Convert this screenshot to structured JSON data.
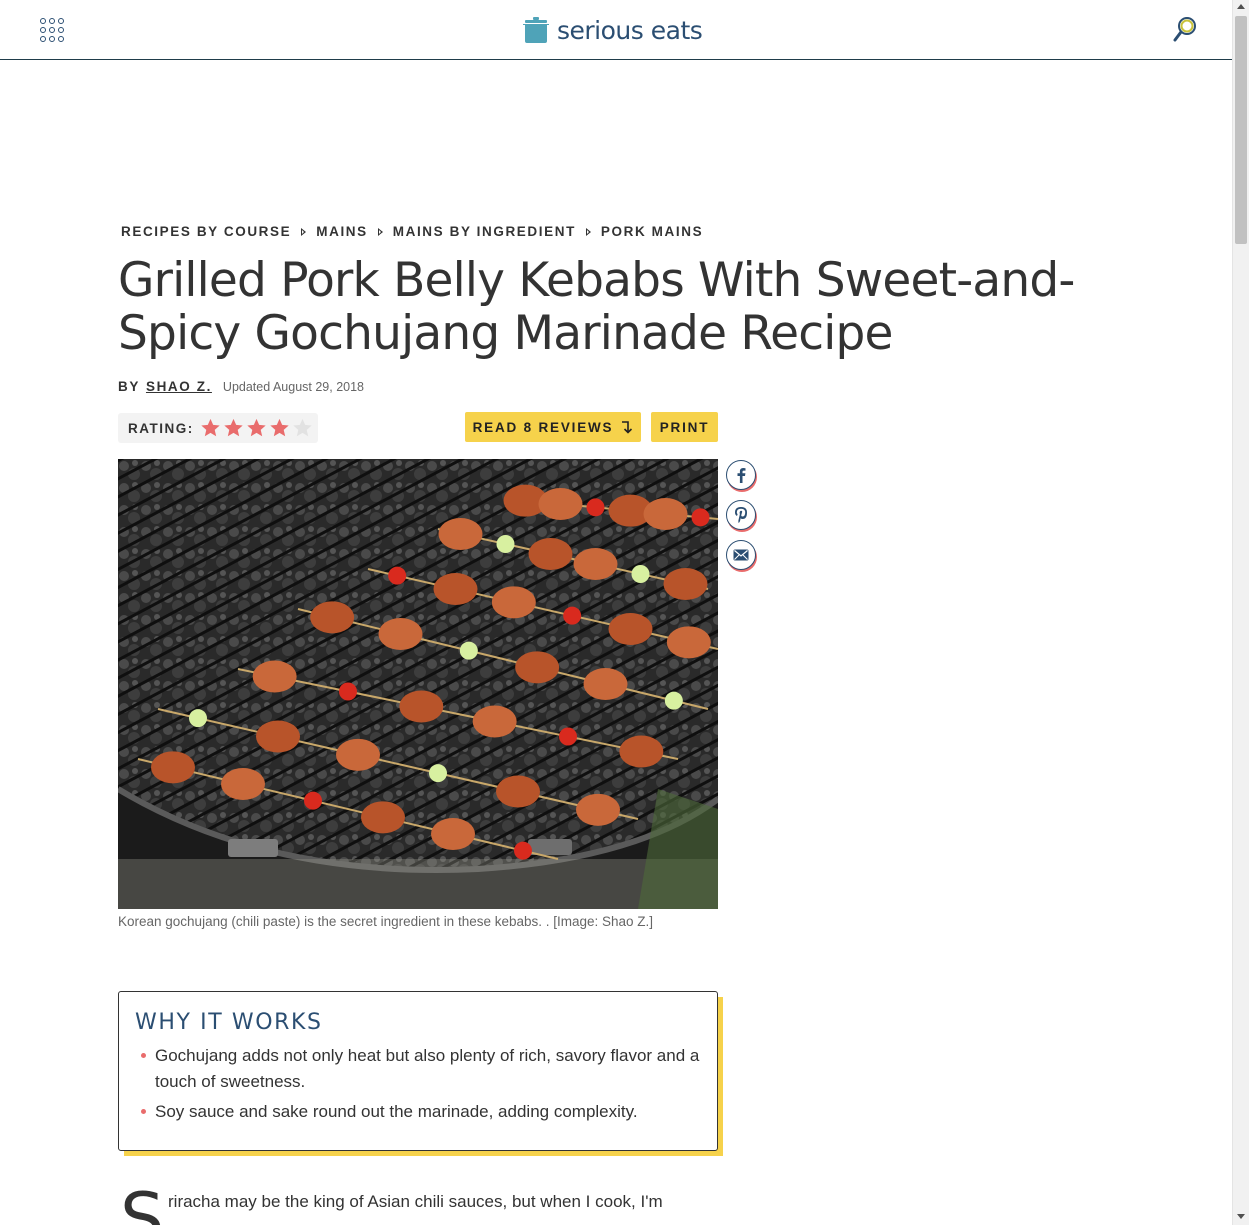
{
  "header": {
    "logo_text": "serious eats"
  },
  "breadcrumb": [
    {
      "label": "RECIPES BY COURSE"
    },
    {
      "label": "MAINS"
    },
    {
      "label": "MAINS BY INGREDIENT"
    },
    {
      "label": "PORK MAINS"
    }
  ],
  "article": {
    "title": "Grilled Pork Belly Kebabs With Sweet-and-Spicy Gochujang Marinade Recipe",
    "by_label": "BY",
    "author": "SHAO Z.",
    "updated": "Updated August 29, 2018",
    "rating_label": "RATING:",
    "rating_value": 4,
    "rating_max": 5,
    "read_reviews_label": "READ 8 REVIEWS",
    "print_label": "PRINT",
    "caption": "Korean gochujang (chili paste) is the secret ingredient in these kebabs. . [Image: Shao Z.]",
    "why_title": "WHY IT WORKS",
    "why_items": [
      "Gochujang adds not only heat but also plenty of rich, savory flavor and a touch of sweetness.",
      "Soy sauce and sake round out the marinade, adding complexity."
    ],
    "dropcap": "S",
    "intro_line1": "riracha may be the king of Asian chili sauces, but when I cook, I'm"
  },
  "share": [
    "facebook-icon",
    "pinterest-icon",
    "email-icon"
  ],
  "colors": {
    "brand_blue": "#2b4e72",
    "accent_yellow": "#f6d24b",
    "star_red": "#e96c6c",
    "logo_teal": "#4fa3b8"
  }
}
